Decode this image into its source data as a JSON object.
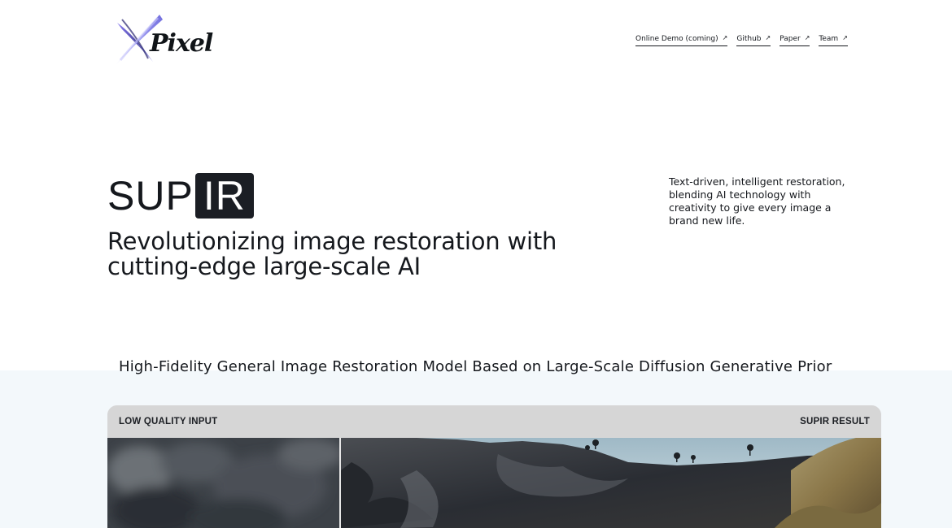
{
  "logo": {
    "text": "Pixel"
  },
  "nav": [
    {
      "label": "Online Demo (coming)",
      "arrow": "↗"
    },
    {
      "label": "Github",
      "arrow": "↗"
    },
    {
      "label": "Paper",
      "arrow": "↗"
    },
    {
      "label": "Team",
      "arrow": "↗"
    }
  ],
  "hero": {
    "brand_plain": "SUP",
    "brand_boxed": "IR",
    "headline": "Revolutionizing image restoration with cutting-edge large-scale AI",
    "tagline": "Text-driven, intelligent restoration, blending AI technology with creativity to give every image a brand new life."
  },
  "section": {
    "subtitle": "High-Fidelity General Image Restoration Model Based on Large-Scale Diffusion Generative Prior"
  },
  "comparison": {
    "left_label": "LOW QUALITY INPUT",
    "right_label": "SUPIR RESULT"
  },
  "colors": {
    "text": "#15181d",
    "brand_box": "#1b1e24",
    "lower_background": "#f3f8fb",
    "compare_bar": "#d6d6d6"
  }
}
